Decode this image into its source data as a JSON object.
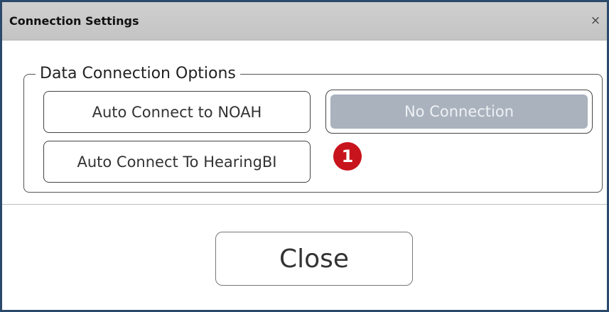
{
  "window": {
    "title": "Connection Settings",
    "close_glyph": "×"
  },
  "group": {
    "legend": "Data Connection Options"
  },
  "buttons": {
    "auto_noah": "Auto Connect to NOAH",
    "no_connection": "No Connection",
    "auto_hearingbi": "Auto Connect To HearingBI",
    "close": "Close"
  },
  "annotation": {
    "badge_number": "1"
  },
  "colors": {
    "title_bar": "#c8c8c8",
    "window_border": "#2b4a6b",
    "selected_button_fill": "#a9b2bd",
    "badge": "#c8141c"
  },
  "state": {
    "selected_option": "No Connection"
  }
}
